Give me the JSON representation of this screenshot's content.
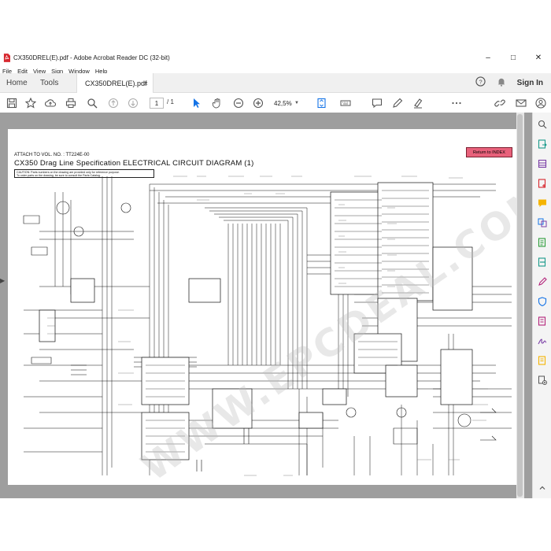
{
  "window": {
    "title": "CX350DREL(E).pdf - Adobe Acrobat Reader DC (32-bit)",
    "minimize": "–",
    "maximize": "□",
    "close": "✕"
  },
  "menu": [
    "File",
    "Edit",
    "View",
    "Sign",
    "Window",
    "Help"
  ],
  "tabs": {
    "home": "Home",
    "tools": "Tools",
    "document": "CX350DREL(E).pdf",
    "close": "×",
    "sign_in": "Sign In"
  },
  "toolbar": {
    "page_current": "1",
    "page_total": "/ 1",
    "zoom": "42,5%"
  },
  "document": {
    "attach_note": "ATTACH TO VOL. NO. : TT224E-00",
    "title": "CX350 Drag Line Specification ELECTRICAL CIRCUIT DIAGRAM (1)",
    "caution_line1": "CAUTION: Parts numbers on the drawing are provided only for reference purpose.",
    "caution_line2": "To order parts on the drawing, be sure to consult the Parts Catalog.",
    "return_button": "Return to INDEX",
    "watermark": "WWW.EPCDEAL.COM"
  },
  "colors": {
    "title_bar_bg": "#ffffff",
    "tab_bar_bg": "#f0f0f0",
    "doc_bg": "#9e9e9e",
    "return_button": "#e8617b",
    "cursor_tool_accent": "#1473e6",
    "pdf_logo": "#d7282f"
  },
  "icons": {
    "pdf_logo": "pdf-logo-icon",
    "help": "help-icon",
    "bell": "bell-icon",
    "save": "save-icon",
    "bookmark": "star-icon",
    "upload": "cloud-upload-icon",
    "print": "print-icon",
    "zoom_search": "search-icon",
    "page_up": "arrow-up-icon",
    "page_down": "arrow-down-icon",
    "select": "cursor-icon",
    "hand": "hand-icon",
    "zoom_out": "zoom-out-icon",
    "zoom_in": "zoom-in-icon",
    "fit": "fit-page-icon",
    "keyboard": "keyboard-icon",
    "comment": "comment-icon",
    "pen": "pen-icon",
    "highlight": "highlight-icon",
    "more": "more-icon",
    "share_link": "link-icon",
    "email": "email-icon",
    "account": "account-icon"
  }
}
